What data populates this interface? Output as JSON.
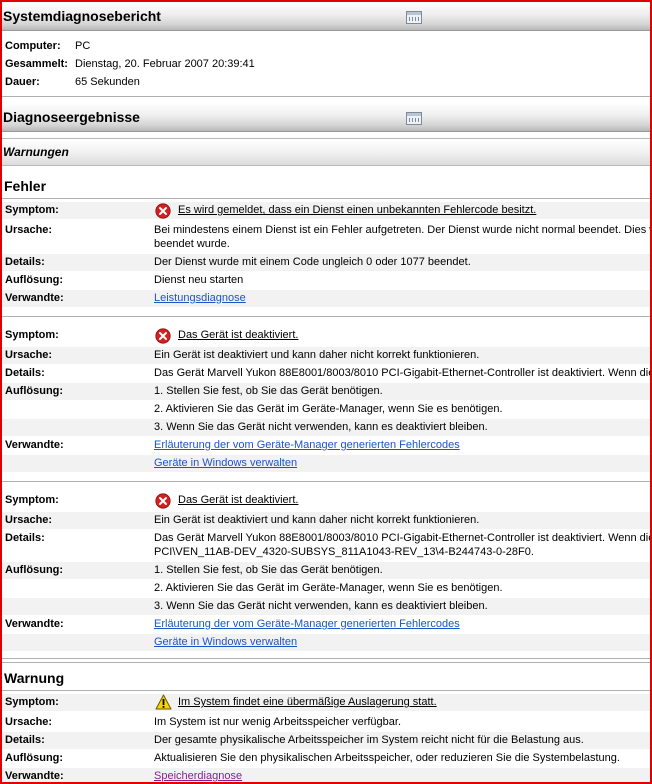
{
  "report": {
    "title": "Systemdiagnosebericht",
    "meta": [
      {
        "label": "Computer:",
        "value": "PC"
      },
      {
        "label": "Gesammelt:",
        "value": "Dienstag, 20. Februar 2007 20:39:41"
      },
      {
        "label": "Dauer:",
        "value": "65 Sekunden"
      }
    ]
  },
  "results": {
    "title": "Diagnoseergebnisse",
    "warnings_header": "Warnungen"
  },
  "labels": {
    "symptom": "Symptom:",
    "cause": "Ursache:",
    "details": "Details:",
    "resolution": "Auflösung:",
    "related": "Verwandte:"
  },
  "errors_section": {
    "title": "Fehler",
    "items": [
      {
        "symptom": "Es wird gemeldet, dass ein Dienst einen unbekannten Fehlercode besitzt.",
        "cause_1": "Bei mindestens einem Dienst ist ein Fehler aufgetreten. Der Dienst wurde nicht normal beendet. Dies w",
        "cause_2": "beendet wurde.",
        "details": "Der Dienst wurde mit einem Code ungleich 0 oder 1077 beendet.",
        "resolution": "Dienst neu starten",
        "related": "Leistungsdiagnose"
      },
      {
        "symptom": "Das Gerät ist deaktiviert.",
        "cause": "Ein Gerät ist deaktiviert und kann daher nicht korrekt funktionieren.",
        "details": "Das Gerät Marvell Yukon 88E8001/8003/8010 PCI-Gigabit-Ethernet-Controller ist deaktiviert. Wenn diese",
        "resolution": [
          "1. Stellen Sie fest, ob Sie das Gerät benötigen.",
          "2. Aktivieren Sie das Gerät im Geräte-Manager, wenn Sie es benötigen.",
          "3. Wenn Sie das Gerät nicht verwenden, kann es deaktiviert bleiben."
        ],
        "related": [
          "Erläuterung der vom Geräte-Manager generierten Fehlercodes",
          "Geräte in Windows verwalten"
        ]
      },
      {
        "symptom": "Das Gerät ist deaktiviert.",
        "cause": "Ein Gerät ist deaktiviert und kann daher nicht korrekt funktionieren.",
        "details_1": "Das Gerät Marvell Yukon 88E8001/8003/8010 PCI-Gigabit-Ethernet-Controller ist deaktiviert. Wenn diese",
        "details_2": "PCI\\VEN_11AB-DEV_4320-SUBSYS_811A1043-REV_13\\4-B244743-0-28F0.",
        "resolution": [
          "1. Stellen Sie fest, ob Sie das Gerät benötigen.",
          "2. Aktivieren Sie das Gerät im Geräte-Manager, wenn Sie es benötigen.",
          "3. Wenn Sie das Gerät nicht verwenden, kann es deaktiviert bleiben."
        ],
        "related": [
          "Erläuterung der vom Geräte-Manager generierten Fehlercodes",
          "Geräte in Windows verwalten"
        ]
      }
    ]
  },
  "warning_section": {
    "title": "Warnung",
    "item": {
      "symptom": "Im System findet eine übermäßige Auslagerung statt.",
      "cause": "Im System ist nur wenig Arbeitsspeicher verfügbar.",
      "details": "Der gesamte physikalische Arbeitsspeicher im System reicht nicht für die Belastung aus.",
      "resolution": "Aktualisieren Sie den physikalischen Arbeitsspeicher, oder reduzieren Sie die Systembelastung.",
      "related": "Speicherdiagnose"
    }
  },
  "icons": {
    "error": "error-circle-icon",
    "warning": "warning-triangle-icon",
    "table": "table-icon"
  },
  "colors": {
    "link": "#1a55c8",
    "visited_link": "#8a1e8a",
    "error_red": "#d42020",
    "warning_yellow": "#f5d400",
    "frame_border": "#e00000"
  }
}
